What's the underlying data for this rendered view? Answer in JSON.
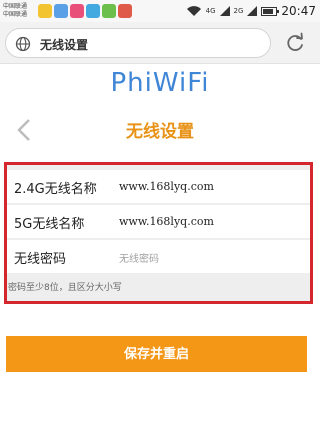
{
  "status_bar": {
    "carrier_1": "中国联通",
    "carrier_2": "中国联通",
    "network_1": "4G",
    "network_2": "2G",
    "time": "20:47"
  },
  "address_bar": {
    "url": "无线设置"
  },
  "logo": {
    "text": "PhiWiFi"
  },
  "page": {
    "title": "无线设置"
  },
  "form": {
    "ssid_24_label": "2.4G无线名称",
    "ssid_24_value": "www.168lyq.com",
    "ssid_5_label": "5G无线名称",
    "ssid_5_value": "www.168lyq.com",
    "password_label": "无线密码",
    "password_placeholder": "无线密码",
    "hint": "密码至少8位，且区分大小写"
  },
  "actions": {
    "save_restart": "保存并重启"
  },
  "colors": {
    "accent": "#f49616",
    "logo": "#3f86d6",
    "highlight_border": "#d4262d"
  }
}
